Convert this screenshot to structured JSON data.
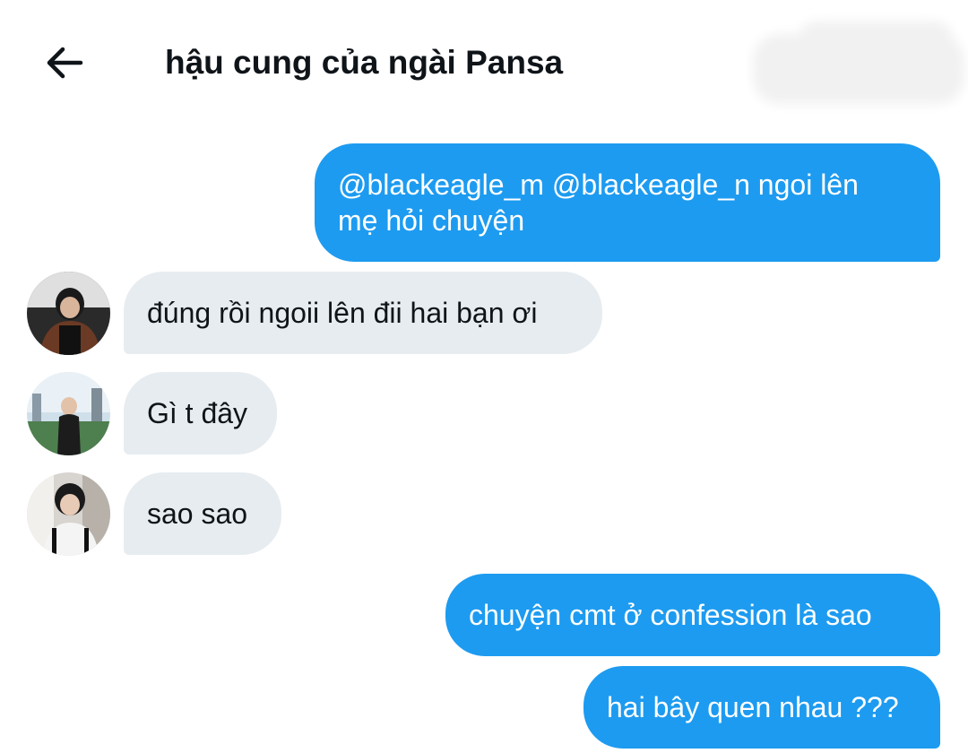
{
  "header": {
    "title": "hậu cung của ngài Pansa",
    "back_icon": "arrow-left-icon"
  },
  "colors": {
    "outgoing_bubble": "#1d9bf0",
    "incoming_bubble": "#e7ecf0",
    "text": "#0f1419"
  },
  "messages": [
    {
      "direction": "outgoing",
      "lines": [
        "@blackeagle_m @blackeagle_n ngoi lên",
        "mẹ hỏi chuyện"
      ]
    },
    {
      "direction": "incoming",
      "text": "đúng rồi ngoii lên đii hai bạn ơi",
      "avatar": "user-avatar-1"
    },
    {
      "direction": "incoming",
      "text": "Gì t đây",
      "avatar": "user-avatar-2"
    },
    {
      "direction": "incoming",
      "text": "sao sao",
      "avatar": "user-avatar-3"
    },
    {
      "direction": "outgoing",
      "text": "chuyện cmt ở confession là sao"
    },
    {
      "direction": "outgoing",
      "text": "hai bây quen nhau ???"
    }
  ]
}
